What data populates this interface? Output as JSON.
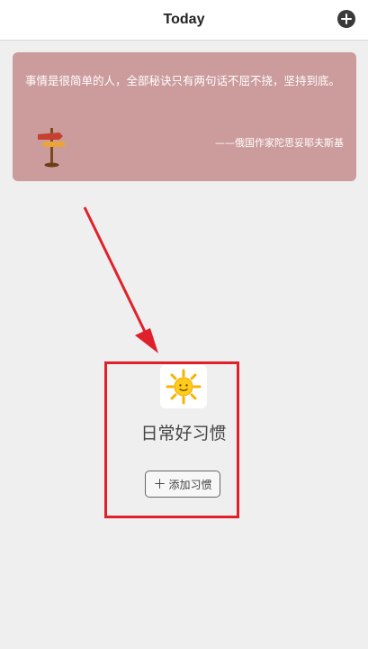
{
  "header": {
    "title": "Today",
    "add_icon": "plus-circle-icon"
  },
  "quote": {
    "text": "事情是很简单的人，全部秘诀只有两句话不屈不挠，坚持到底。",
    "author": "——俄国作家陀思妥耶夫斯基",
    "background_color": "#cc9b9c",
    "icon": "signpost-icon"
  },
  "empty_state": {
    "icon": "sun-icon",
    "title": "日常好习惯",
    "button_label": "添加习惯",
    "button_icon": "plus-icon"
  },
  "annotation": {
    "color": "#e0212b"
  }
}
